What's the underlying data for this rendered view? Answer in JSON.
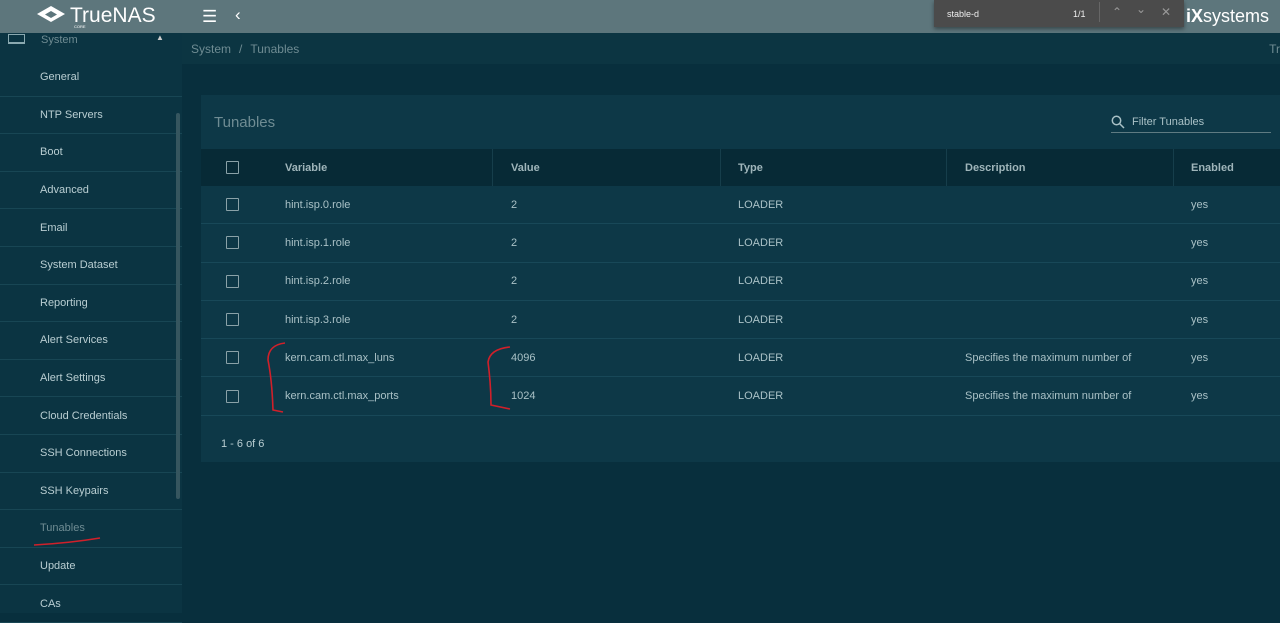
{
  "topbar": {
    "brand": "TrueNAS",
    "edition": "CORE",
    "partner": "systems",
    "menu_icon": "menu-icon",
    "back_icon": "chevron-left-icon"
  },
  "find": {
    "query": "stable-d",
    "count": "1/1"
  },
  "sidebar": {
    "section": "System",
    "items": [
      "General",
      "NTP Servers",
      "Boot",
      "Advanced",
      "Email",
      "System Dataset",
      "Reporting",
      "Alert Services",
      "Alert Settings",
      "Cloud Credentials",
      "SSH Connections",
      "SSH Keypairs",
      "Tunables",
      "Update",
      "CAs"
    ],
    "active": "Tunables"
  },
  "breadcrumb": {
    "parent": "System",
    "current": "Tunables",
    "right": "Tr"
  },
  "card": {
    "title": "Tunables",
    "filter_placeholder": "Filter Tunables",
    "columns": [
      "Variable",
      "Value",
      "Type",
      "Description",
      "Enabled"
    ],
    "rows": [
      [
        "hint.isp.0.role",
        "2",
        "LOADER",
        "",
        "yes"
      ],
      [
        "hint.isp.1.role",
        "2",
        "LOADER",
        "",
        "yes"
      ],
      [
        "hint.isp.2.role",
        "2",
        "LOADER",
        "",
        "yes"
      ],
      [
        "hint.isp.3.role",
        "2",
        "LOADER",
        "",
        "yes"
      ],
      [
        "kern.cam.ctl.max_luns",
        "4096",
        "LOADER",
        "Specifies the maximum number of LUNs і",
        "yes"
      ],
      [
        "kern.cam.ctl.max_ports",
        "1024",
        "LOADER",
        "Specifies the maximum number of ports і",
        "yes"
      ]
    ],
    "pagination": "1 - 6 of 6"
  },
  "colors": {
    "topbar": "#5d767c",
    "sidebar": "#0b3442",
    "card": "#0d3847",
    "annotation": "#d0202a"
  }
}
